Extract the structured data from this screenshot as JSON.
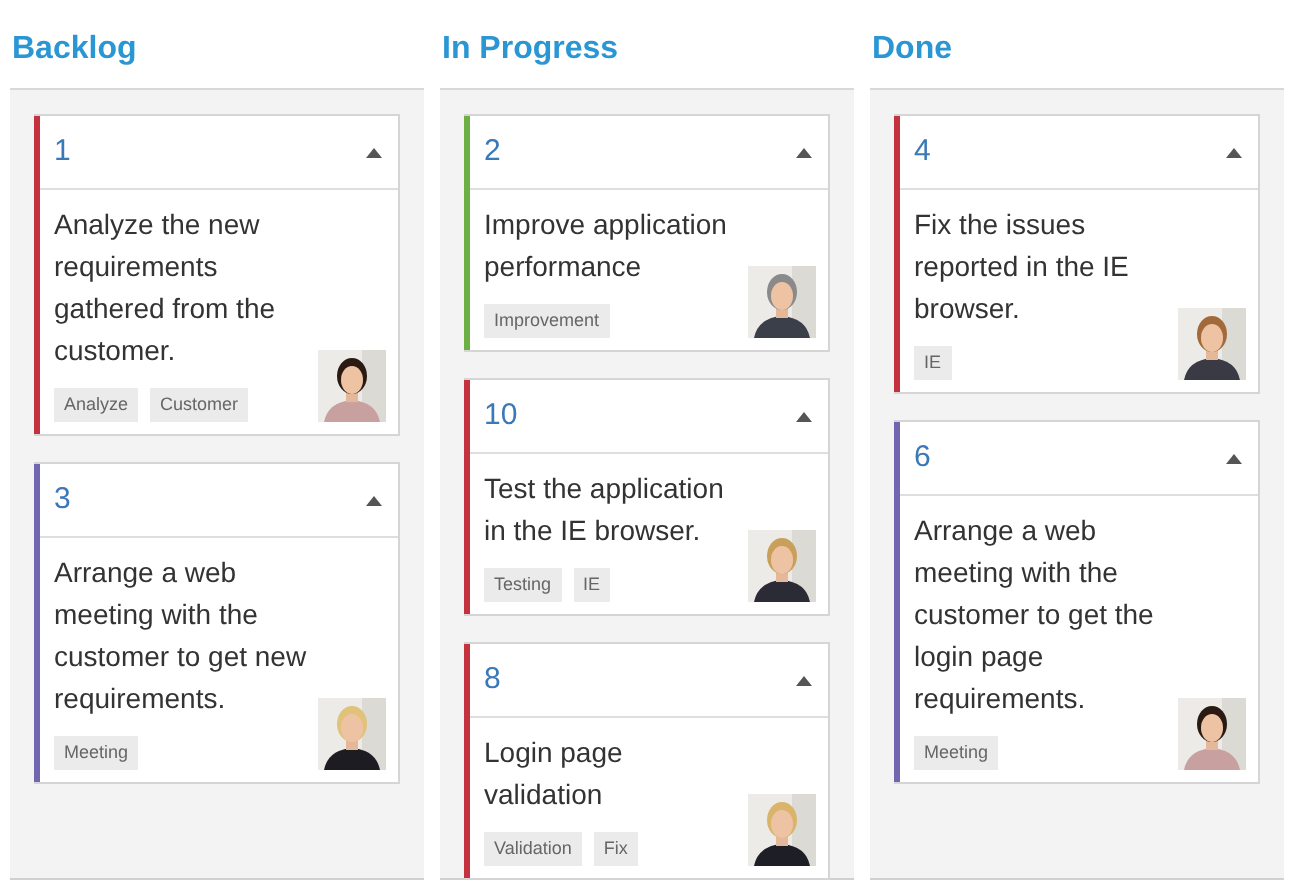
{
  "columns": [
    {
      "title": "Backlog",
      "cards": [
        {
          "id": "1",
          "color": "#c4313f",
          "text": "Analyze the new requirements gathered from the customer.",
          "tags": [
            "Analyze",
            "Customer"
          ]
        },
        {
          "id": "3",
          "color": "#7067b0",
          "text": "Arrange a web meeting with the customer to get new requirements.",
          "tags": [
            "Meeting"
          ]
        }
      ]
    },
    {
      "title": "In Progress",
      "cards": [
        {
          "id": "2",
          "color": "#6cb043",
          "text": "Improve application performance",
          "tags": [
            "Improvement"
          ]
        },
        {
          "id": "10",
          "color": "#c4313f",
          "text": "Test the application in the IE browser.",
          "tags": [
            "Testing",
            "IE"
          ]
        },
        {
          "id": "8",
          "color": "#c4313f",
          "text": "Login page validation",
          "tags": [
            "Validation",
            "Fix"
          ]
        }
      ]
    },
    {
      "title": "Done",
      "cards": [
        {
          "id": "4",
          "color": "#c4313f",
          "text": "Fix the issues reported in the IE browser.",
          "tags": [
            "IE"
          ]
        },
        {
          "id": "6",
          "color": "#7067b0",
          "text": "Arrange a web meeting with the customer to get the login page requirements.",
          "tags": [
            "Meeting"
          ]
        }
      ]
    }
  ]
}
